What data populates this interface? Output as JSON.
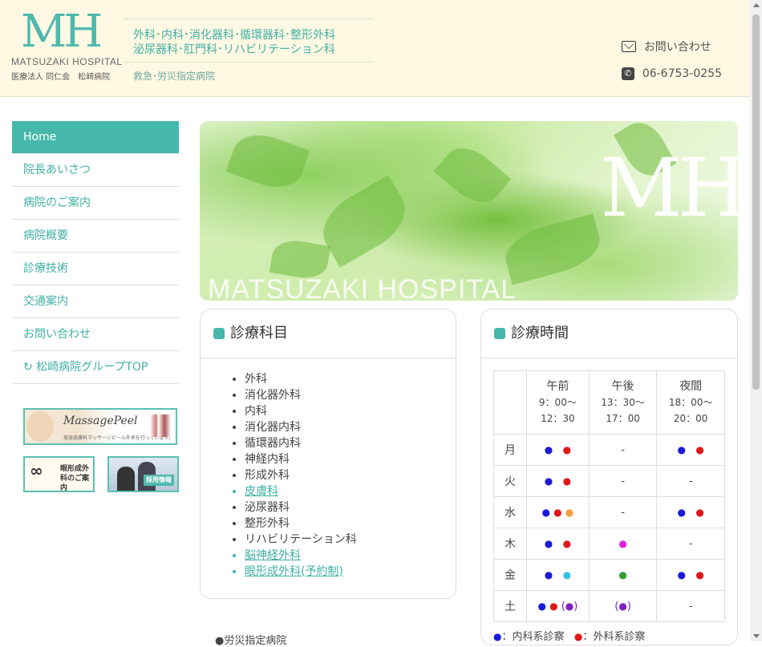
{
  "header": {
    "logo_mark": "MH",
    "logo_en": "MATSUZAKI HOSPITAL",
    "logo_jp": "医療法人 同仁会　松崎病院",
    "depts_line1": "外科･内科･消化器科･循環器科･整形外科",
    "depts_line2": "泌尿器科･肛門科･リハビリテーション科",
    "emergency": "救急･労災指定病院",
    "contact_label": "お問い合わせ",
    "phone": "06-6753-0255",
    "icons": [
      "mail-icon",
      "phone-icon"
    ]
  },
  "sidebar": {
    "items": [
      {
        "label": "Home",
        "active": true
      },
      {
        "label": "院長あいさつ"
      },
      {
        "label": "病院のご案内"
      },
      {
        "label": "病院概要"
      },
      {
        "label": "診療技術"
      },
      {
        "label": "交通案内"
      },
      {
        "label": "お問い合わせ"
      },
      {
        "label": "松崎病院グループTOP",
        "icon": "refresh-icon"
      }
    ],
    "banners": {
      "massage_title": "MassagePeel",
      "massage_sub": "美容皮膚科マッサージピール外来を行っています。",
      "eye_text": "眼形成外科のご案内",
      "job_text": "採用情報"
    }
  },
  "hero": {
    "mark": "MH",
    "name": "MATSUZAKI HOSPITAL"
  },
  "departments": {
    "title": "診療科目",
    "items": [
      {
        "label": "外科"
      },
      {
        "label": "消化器外科"
      },
      {
        "label": "内科"
      },
      {
        "label": "消化器内科"
      },
      {
        "label": "循環器内科"
      },
      {
        "label": "神経内科"
      },
      {
        "label": "形成外科"
      },
      {
        "label": "皮膚科",
        "link": true
      },
      {
        "label": "泌尿器科"
      },
      {
        "label": "整形外科"
      },
      {
        "label": "リハビリテーション科"
      },
      {
        "label": "脳神経外科",
        "link": true
      },
      {
        "label": "眼形成外科(予約制)",
        "link": true
      }
    ]
  },
  "hours": {
    "title": "診療時間",
    "columns": [
      {
        "name": "午前",
        "start": "9：00〜",
        "end": "12：30"
      },
      {
        "name": "午後",
        "start": "13：30〜",
        "end": "17：00"
      },
      {
        "name": "夜間",
        "start": "18：00〜",
        "end": "20：00"
      }
    ],
    "dash": "-",
    "days": [
      "月",
      "火",
      "水",
      "木",
      "金",
      "土"
    ],
    "legend_internal": "：内科系診察",
    "legend_surgical": "：外科系診察",
    "bullet": "●",
    "colors": {
      "internal": "#1a1ad8",
      "surgical": "#e01818",
      "orange": "#f0a040",
      "cyan": "#3ac0e8",
      "magenta": "#e020e0",
      "green": "#30a030",
      "purple": "#8020c0"
    }
  },
  "note": "●労災指定病院"
}
